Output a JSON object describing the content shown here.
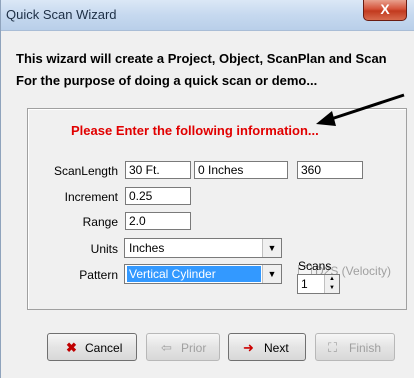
{
  "window": {
    "title": "Quick Scan Wizard",
    "close_label": "X"
  },
  "intro": {
    "line1": "This wizard will create a Project, Object, ScanPlan and Scan",
    "line2": "For the purpose of doing a quick scan or demo..."
  },
  "prompt": "Please Enter the following information...",
  "form": {
    "scanlength_label": "ScanLength",
    "scanlength_feet": "30  Ft.",
    "scanlength_inches": "0  Inches",
    "scanlength_degrees": "360",
    "increment_label": "Increment",
    "increment_value": "0.25",
    "range_label": "Range",
    "range_value": "2.0",
    "units_label": "Units",
    "units_value": "Inches",
    "d2s_label": "D2S (Velocity)",
    "pattern_label": "Pattern",
    "pattern_value": "Vertical Cylinder",
    "scans_label": "Scans",
    "scans_value": "1"
  },
  "buttons": {
    "cancel": "Cancel",
    "prior": "Prior",
    "next": "Next",
    "finish": "Finish"
  },
  "colors": {
    "prompt": "#e10000",
    "selection": "#3399ff",
    "next_arrow": "#cc0000"
  },
  "icons": [
    "close-icon",
    "arrow-annotation-icon",
    "cancel-x-icon",
    "prior-arrow-icon",
    "next-arrow-icon",
    "finish-icon"
  ]
}
